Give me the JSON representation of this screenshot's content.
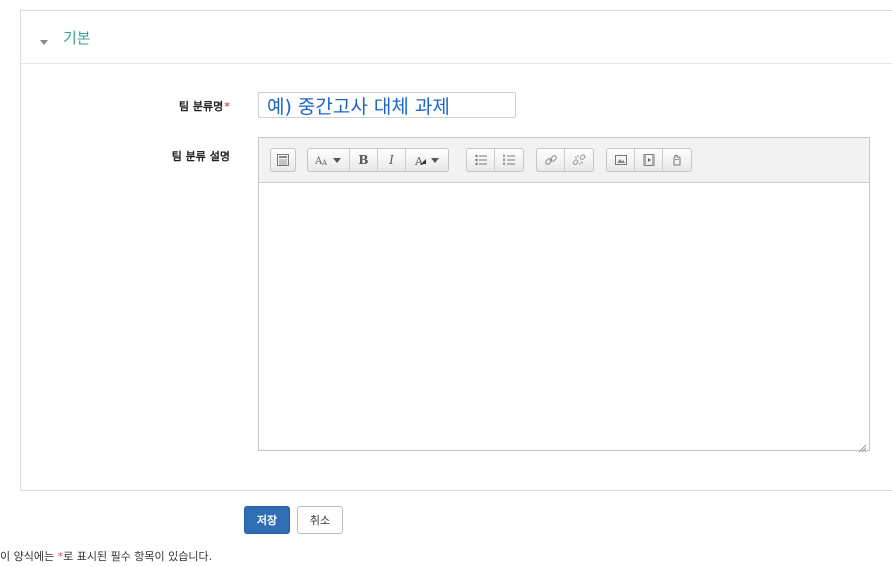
{
  "section": {
    "title": "기본"
  },
  "fields": {
    "name_label": "팀 분류명",
    "required_mark": "*",
    "name_value": "예) 중간고사 대체 과제",
    "desc_label": "팀 분류 설명"
  },
  "toolbar": {
    "icons": [
      "toolbar-toggle-icon",
      "font-size-icon",
      "bold-icon",
      "italic-icon",
      "font-color-icon",
      "unordered-list-icon",
      "ordered-list-icon",
      "link-icon",
      "unlink-icon",
      "image-icon",
      "media-icon",
      "file-manage-icon"
    ],
    "bold_glyph": "B",
    "italic_glyph": "I"
  },
  "actions": {
    "save_label": "저장",
    "cancel_label": "취소"
  },
  "footnote": {
    "before": "이 양식에는 ",
    "mark": "*",
    "after": "로 표시된 필수 항목이 있습니다."
  },
  "colors": {
    "accent": "#3aa590",
    "primary_button": "#2f6eb5",
    "required": "#d9534f",
    "input_text": "#1c66c9"
  }
}
